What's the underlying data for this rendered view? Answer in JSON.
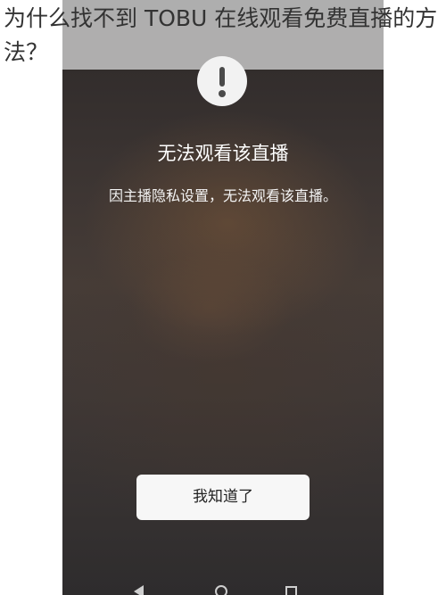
{
  "article": {
    "question_title": "为什么找不到 TOBU 在线观看免费直播的方法？"
  },
  "dialog": {
    "icon": "exclamation-icon",
    "title": "无法观看该直播",
    "message": "因主播隐私设置，无法观看该直播。",
    "button_label": "我知道了"
  },
  "navigation_bar": {
    "icons": [
      "back-icon",
      "home-icon",
      "recent-apps-icon"
    ]
  },
  "colors": {
    "dialog_button_bg": "#f7f7f7",
    "dialog_text": "#ffffff",
    "overlay_dark": "#3b3432"
  }
}
